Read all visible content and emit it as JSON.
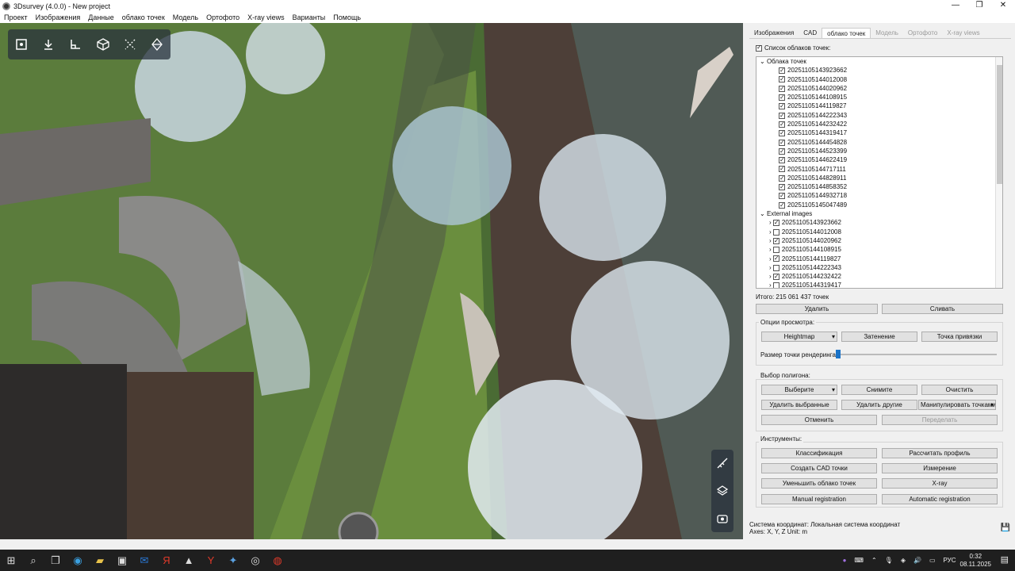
{
  "window": {
    "title": "3Dsurvey (4.0.0) - New project",
    "minimize": "—",
    "maximize": "❐",
    "close": "✕"
  },
  "menu": [
    "Проект",
    "Изображения",
    "Данные",
    "облако точек",
    "Модель",
    "Ортофото",
    "X-ray views",
    "Варианты",
    "Помощь"
  ],
  "panel": {
    "tabs": [
      "Изображения",
      "CAD",
      "облако точек",
      "Модель",
      "Ортофото",
      "X-ray views"
    ],
    "active_tab": "облако точек",
    "cloud_list_label": "Список облаков точек:",
    "group_clouds": "Облака точек",
    "clouds": [
      "20251105143923662",
      "20251105144012008",
      "20251105144020962",
      "20251105144108915",
      "20251105144119827",
      "20251105144222343",
      "20251105144232422",
      "20251105144319417",
      "20251105144454828",
      "20251105144523399",
      "20251105144622419",
      "20251105144717111",
      "20251105144828911",
      "20251105144858352",
      "20251105144932718",
      "20251105145047489"
    ],
    "group_external": "External images",
    "external": [
      {
        "name": "20251105143923662",
        "checked": true
      },
      {
        "name": "20251105144012008",
        "checked": false
      },
      {
        "name": "20251105144020962",
        "checked": true
      },
      {
        "name": "20251105144108915",
        "checked": false
      },
      {
        "name": "20251105144119827",
        "checked": true
      },
      {
        "name": "20251105144222343",
        "checked": false
      },
      {
        "name": "20251105144232422",
        "checked": true
      },
      {
        "name": "20251105144319417",
        "checked": false
      }
    ],
    "total": "Итого: 215 061 437 точек",
    "delete_btn": "Удалить",
    "merge_btn": "Сливать",
    "view_options": "Опции просмотра:",
    "heightmap": "Heightmap",
    "shading": "Затенение",
    "snap_point": "Точка привязки",
    "render_size": "Размер точки рендеринга:",
    "polygon_select": "Выбор полигона:",
    "select": "Выберите",
    "deselect": "Снимите",
    "clear": "Очистить",
    "delete_selected": "Удалить выбранные",
    "delete_others": "Удалить другие",
    "manipulate": "Манипулировать точками",
    "undo": "Отменить",
    "redo": "Переделать",
    "tools": "Инструменты:",
    "classification": "Классификация",
    "calc_profile": "Рассчитать профиль",
    "create_cad": "Создать CAD точки",
    "measure": "Измерение",
    "reduce_cloud": "Уменьшить облако точек",
    "xray": "X-ray",
    "manual_reg": "Manual registration",
    "auto_reg": "Automatic registration"
  },
  "status": {
    "coord_system": "Система координат: Локальная система координат",
    "axes": "Axes: X, Y, Z Unit: m"
  },
  "taskbar": {
    "lang": "РУС",
    "time": "0:32",
    "date": "08.11.2025"
  }
}
